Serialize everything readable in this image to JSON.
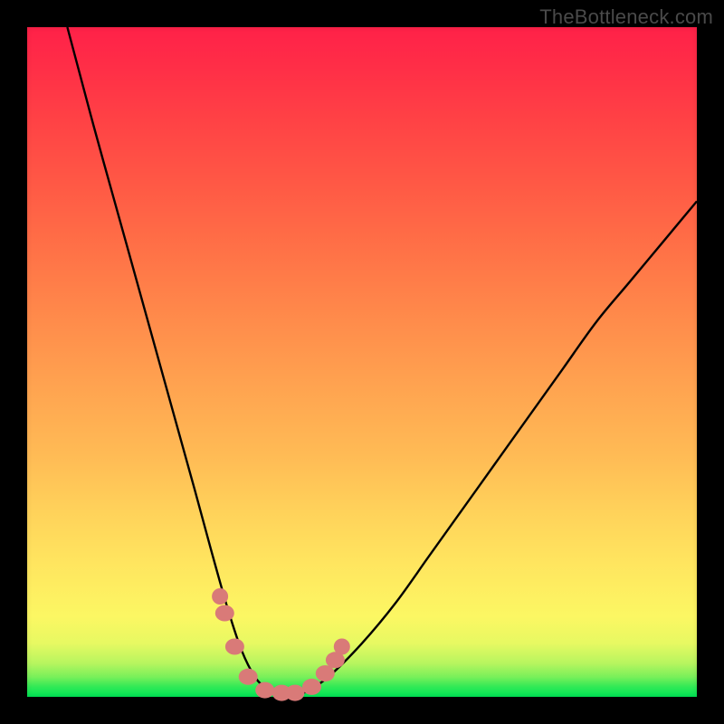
{
  "watermark": "TheBottleneck.com",
  "colors": {
    "background": "#000000",
    "curve": "#000000",
    "marker": "#d97a78",
    "gradient_stops": [
      "#00e756",
      "#fcf763",
      "#ff8c4b",
      "#ff2148"
    ]
  },
  "chart_data": {
    "type": "line",
    "title": "",
    "xlabel": "",
    "ylabel": "",
    "xlim": [
      0,
      100
    ],
    "ylim": [
      0,
      100
    ],
    "legend": false,
    "grid": false,
    "background_meaning": "color gradient encodes bottleneck severity: green ≈ 0%, yellow ≈ mid, red ≈ 100%",
    "series": [
      {
        "name": "bottleneck-curve",
        "x": [
          6,
          10,
          15,
          20,
          25,
          28,
          30,
          32,
          34,
          36,
          38,
          40,
          42,
          45,
          50,
          55,
          60,
          65,
          70,
          75,
          80,
          85,
          90,
          95,
          100
        ],
        "y": [
          100,
          85,
          67,
          49,
          31,
          20,
          13,
          7,
          3,
          1,
          0,
          0,
          1,
          3,
          8,
          14,
          21,
          28,
          35,
          42,
          49,
          56,
          62,
          68,
          74
        ]
      }
    ],
    "annotations": [
      {
        "type": "markers",
        "shape": "circle",
        "color": "#d97a78",
        "points_xy": [
          [
            28.8,
            15.0
          ],
          [
            29.5,
            12.5
          ],
          [
            31.0,
            7.5
          ],
          [
            33.0,
            3.0
          ],
          [
            35.5,
            1.0
          ],
          [
            38.0,
            0.6
          ],
          [
            40.0,
            0.6
          ],
          [
            42.5,
            1.5
          ],
          [
            44.5,
            3.5
          ],
          [
            46.0,
            5.5
          ],
          [
            47.0,
            7.5
          ]
        ]
      }
    ],
    "minimum": {
      "x": 39,
      "y": 0
    }
  }
}
